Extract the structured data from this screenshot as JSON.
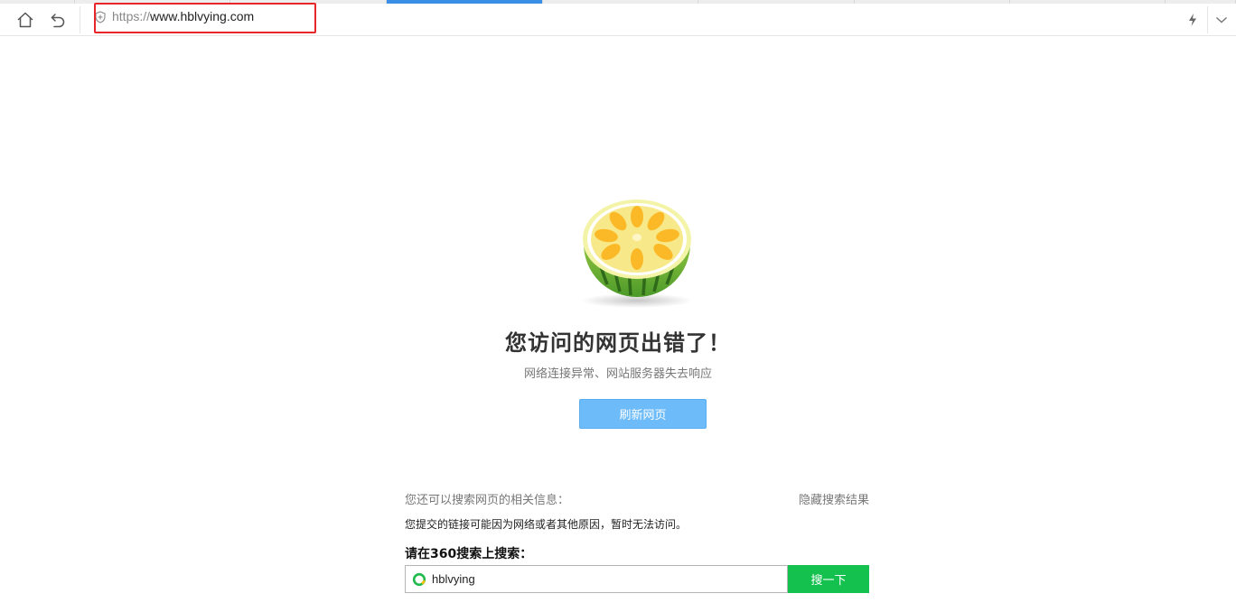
{
  "toolbar": {
    "address": {
      "scheme": "https://",
      "host": "www.hblvying.com"
    }
  },
  "icons": {
    "home": "home-icon",
    "back": "undo-back-icon",
    "security": "shield-icon",
    "accelerate": "lightning-icon",
    "menu": "chevron-down-icon"
  },
  "error_page": {
    "title": "您访问的网页出错了！",
    "subtitle": "网络连接异常、网站服务器失去响应",
    "refresh_label": "刷新网页",
    "search_info": "您还可以搜索网页的相关信息：",
    "hide_results": "隐藏搜索结果",
    "reason": "您提交的链接可能因为网络或者其他原因，暂时无法访问。",
    "search_label": "请在360搜索上搜索：",
    "search_value": "hblvying",
    "search_button": "搜一下"
  },
  "colors": {
    "accent": "#3a8ee6",
    "highlight_border": "#e8262a",
    "refresh_button": "#6dbbf9",
    "search_button": "#14c14e"
  }
}
